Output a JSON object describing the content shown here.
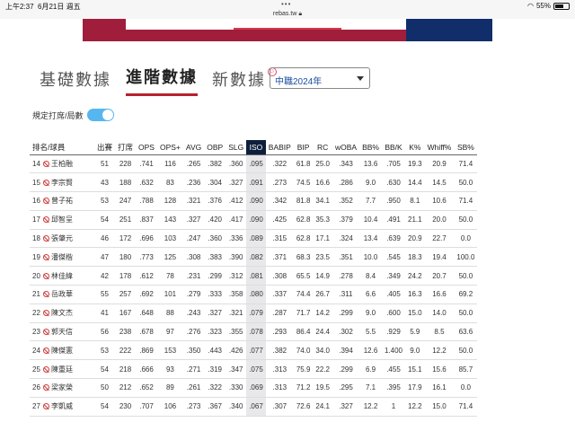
{
  "status": {
    "time": "上午2:37",
    "date": "6月21日 週五",
    "battery": "55%",
    "url": "rebas.tw"
  },
  "tabs": [
    {
      "label": "基礎數據",
      "active": false
    },
    {
      "label": "進階數據",
      "active": true
    },
    {
      "label": "新數據",
      "active": false
    }
  ],
  "league_select": {
    "value": "中職2024年"
  },
  "toggle": {
    "label": "規定打席/局數",
    "on": true
  },
  "columns": [
    "排名/球員",
    "出賽",
    "打席",
    "OPS",
    "OPS+",
    "AVG",
    "OBP",
    "SLG",
    "ISO",
    "BABIP",
    "BIP",
    "RC",
    "wOBA",
    "BB%",
    "BB/K",
    "K%",
    "Whiff%",
    "SB%"
  ],
  "rows": [
    {
      "rank": "14",
      "name": "王柏融",
      "g": "51",
      "pa": "228",
      "ops": ".741",
      "opsp": "116",
      "avg": ".265",
      "obp": ".382",
      "slg": ".360",
      "iso": ".095",
      "babip": ".322",
      "bip": "61.8",
      "rc": "25.0",
      "woba": ".343",
      "bbp": "13.6",
      "bbk": ".705",
      "kp": "19.3",
      "whiff": "20.9",
      "sbp": "71.4"
    },
    {
      "rank": "15",
      "name": "李宗賢",
      "g": "43",
      "pa": "188",
      "ops": ".632",
      "opsp": "83",
      "avg": ".236",
      "obp": ".304",
      "slg": ".327",
      "iso": ".091",
      "babip": ".273",
      "bip": "74.5",
      "rc": "16.6",
      "woba": ".286",
      "bbp": "9.0",
      "bbk": ".630",
      "kp": "14.4",
      "whiff": "14.5",
      "sbp": "50.0"
    },
    {
      "rank": "16",
      "name": "曾子祐",
      "g": "53",
      "pa": "247",
      "ops": ".788",
      "opsp": "128",
      "avg": ".321",
      "obp": ".376",
      "slg": ".412",
      "iso": ".090",
      "babip": ".342",
      "bip": "81.8",
      "rc": "34.1",
      "woba": ".352",
      "bbp": "7.7",
      "bbk": ".950",
      "kp": "8.1",
      "whiff": "10.6",
      "sbp": "71.4"
    },
    {
      "rank": "17",
      "name": "邱智呈",
      "g": "54",
      "pa": "251",
      "ops": ".837",
      "opsp": "143",
      "avg": ".327",
      "obp": ".420",
      "slg": ".417",
      "iso": ".090",
      "babip": ".425",
      "bip": "62.8",
      "rc": "35.3",
      "woba": ".379",
      "bbp": "10.4",
      "bbk": ".491",
      "kp": "21.1",
      "whiff": "20.0",
      "sbp": "50.0"
    },
    {
      "rank": "18",
      "name": "張肇元",
      "g": "46",
      "pa": "172",
      "ops": ".696",
      "opsp": "103",
      "avg": ".247",
      "obp": ".360",
      "slg": ".336",
      "iso": ".089",
      "babip": ".315",
      "bip": "62.8",
      "rc": "17.1",
      "woba": ".324",
      "bbp": "13.4",
      "bbk": ".639",
      "kp": "20.9",
      "whiff": "22.7",
      "sbp": "0.0"
    },
    {
      "rank": "19",
      "name": "潘傑楷",
      "g": "47",
      "pa": "180",
      "ops": ".773",
      "opsp": "125",
      "avg": ".308",
      "obp": ".383",
      "slg": ".390",
      "iso": ".082",
      "babip": ".371",
      "bip": "68.3",
      "rc": "23.5",
      "woba": ".351",
      "bbp": "10.0",
      "bbk": ".545",
      "kp": "18.3",
      "whiff": "19.4",
      "sbp": "100.0"
    },
    {
      "rank": "20",
      "name": "林佳緯",
      "g": "42",
      "pa": "178",
      "ops": ".612",
      "opsp": "78",
      "avg": ".231",
      "obp": ".299",
      "slg": ".312",
      "iso": ".081",
      "babip": ".308",
      "bip": "65.5",
      "rc": "14.9",
      "woba": ".278",
      "bbp": "8.4",
      "bbk": ".349",
      "kp": "24.2",
      "whiff": "20.7",
      "sbp": "50.0"
    },
    {
      "rank": "21",
      "name": "岳政華",
      "g": "55",
      "pa": "257",
      "ops": ".692",
      "opsp": "101",
      "avg": ".279",
      "obp": ".333",
      "slg": ".358",
      "iso": ".080",
      "babip": ".337",
      "bip": "74.4",
      "rc": "26.7",
      "woba": ".311",
      "bbp": "6.6",
      "bbk": ".405",
      "kp": "16.3",
      "whiff": "16.6",
      "sbp": "69.2"
    },
    {
      "rank": "22",
      "name": "陳文杰",
      "g": "41",
      "pa": "167",
      "ops": ".648",
      "opsp": "88",
      "avg": ".243",
      "obp": ".327",
      "slg": ".321",
      "iso": ".079",
      "babip": ".287",
      "bip": "71.7",
      "rc": "14.2",
      "woba": ".299",
      "bbp": "9.0",
      "bbk": ".600",
      "kp": "15.0",
      "whiff": "14.0",
      "sbp": "50.0"
    },
    {
      "rank": "23",
      "name": "郭天信",
      "g": "56",
      "pa": "238",
      "ops": ".678",
      "opsp": "97",
      "avg": ".276",
      "obp": ".323",
      "slg": ".355",
      "iso": ".078",
      "babip": ".293",
      "bip": "86.4",
      "rc": "24.4",
      "woba": ".302",
      "bbp": "5.5",
      "bbk": ".929",
      "kp": "5.9",
      "whiff": "8.5",
      "sbp": "63.6"
    },
    {
      "rank": "24",
      "name": "陳傑憲",
      "g": "53",
      "pa": "222",
      "ops": ".869",
      "opsp": "153",
      "avg": ".350",
      "obp": ".443",
      "slg": ".426",
      "iso": ".077",
      "babip": ".382",
      "bip": "74.0",
      "rc": "34.0",
      "woba": ".394",
      "bbp": "12.6",
      "bbk": "1.400",
      "kp": "9.0",
      "whiff": "12.2",
      "sbp": "50.0"
    },
    {
      "rank": "25",
      "name": "陳重廷",
      "g": "54",
      "pa": "218",
      "ops": ".666",
      "opsp": "93",
      "avg": ".271",
      "obp": ".319",
      "slg": ".347",
      "iso": ".075",
      "babip": ".313",
      "bip": "75.9",
      "rc": "22.2",
      "woba": ".299",
      "bbp": "6.9",
      "bbk": ".455",
      "kp": "15.1",
      "whiff": "15.6",
      "sbp": "85.7"
    },
    {
      "rank": "26",
      "name": "梁家榮",
      "g": "50",
      "pa": "212",
      "ops": ".652",
      "opsp": "89",
      "avg": ".261",
      "obp": ".322",
      "slg": ".330",
      "iso": ".069",
      "babip": ".313",
      "bip": "71.2",
      "rc": "19.5",
      "woba": ".295",
      "bbp": "7.1",
      "bbk": ".395",
      "kp": "17.9",
      "whiff": "16.1",
      "sbp": "0.0"
    },
    {
      "rank": "27",
      "name": "李凱威",
      "g": "54",
      "pa": "230",
      "ops": ".707",
      "opsp": "106",
      "avg": ".273",
      "obp": ".367",
      "slg": ".340",
      "iso": ".067",
      "babip": ".307",
      "bip": "72.6",
      "rc": "24.1",
      "woba": ".327",
      "bbp": "12.2",
      "bbk": "1",
      "kp": "12.2",
      "whiff": "15.0",
      "sbp": "71.4"
    }
  ]
}
